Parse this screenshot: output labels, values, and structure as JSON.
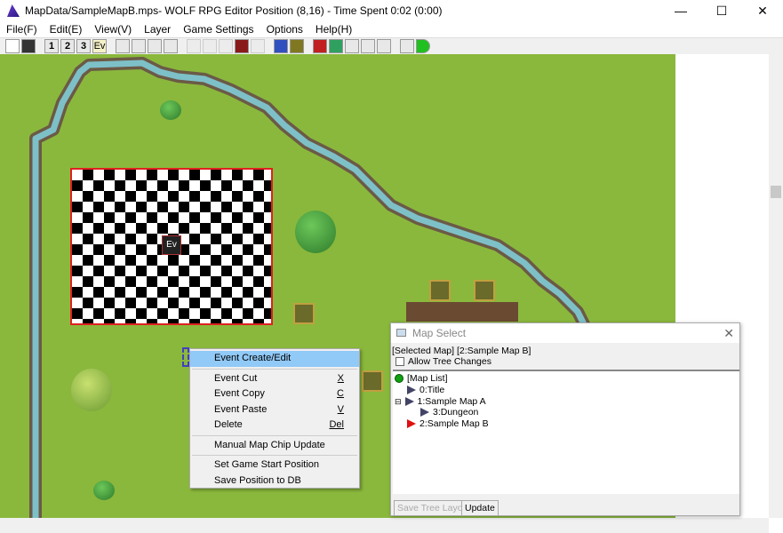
{
  "window": {
    "title": "MapData/SampleMapB.mps- WOLF RPG Editor Position (8,16)  - Time Spent 0:02 (0:00)",
    "minimize": "—",
    "maximize": "☐",
    "close": "✕"
  },
  "menu": [
    "File(F)",
    "Edit(E)",
    "View(V)",
    "Layer",
    "Game Settings",
    "Options",
    "Help(H)"
  ],
  "toolbar": [
    "new",
    "save",
    "1",
    "2",
    "3",
    "Ev",
    "layer-a",
    "layer-b",
    "layer-c",
    "layer-d",
    "pencil",
    "fill",
    "rect",
    "event-tool",
    "undo",
    "db-user",
    "db-sys",
    "db-var",
    "chip-set",
    "wrench",
    "char",
    "map",
    "list",
    "run"
  ],
  "map": {
    "event_label": "Ev"
  },
  "context_menu": {
    "items": [
      {
        "label": "Event Create/Edit",
        "key": ""
      },
      {
        "label": "Event Cut",
        "key": "X"
      },
      {
        "label": "Event Copy",
        "key": "C"
      },
      {
        "label": "Event Paste",
        "key": "V"
      },
      {
        "label": "Delete",
        "key": "Del"
      },
      {
        "label": "Manual Map Chip Update",
        "key": ""
      },
      {
        "label": "Set Game Start Position",
        "key": ""
      },
      {
        "label": "Save Position to DB",
        "key": ""
      }
    ]
  },
  "map_select": {
    "title": "Map Select",
    "selected": "[Selected Map]  [2:Sample Map B]",
    "allow": "Allow Tree Changes",
    "tree": [
      "[Map List]",
      "0:Title",
      "1:Sample Map A",
      "3:Dungeon",
      "2:Sample Map B"
    ],
    "save_btn": "Save Tree Layout",
    "update_btn": "Update"
  }
}
